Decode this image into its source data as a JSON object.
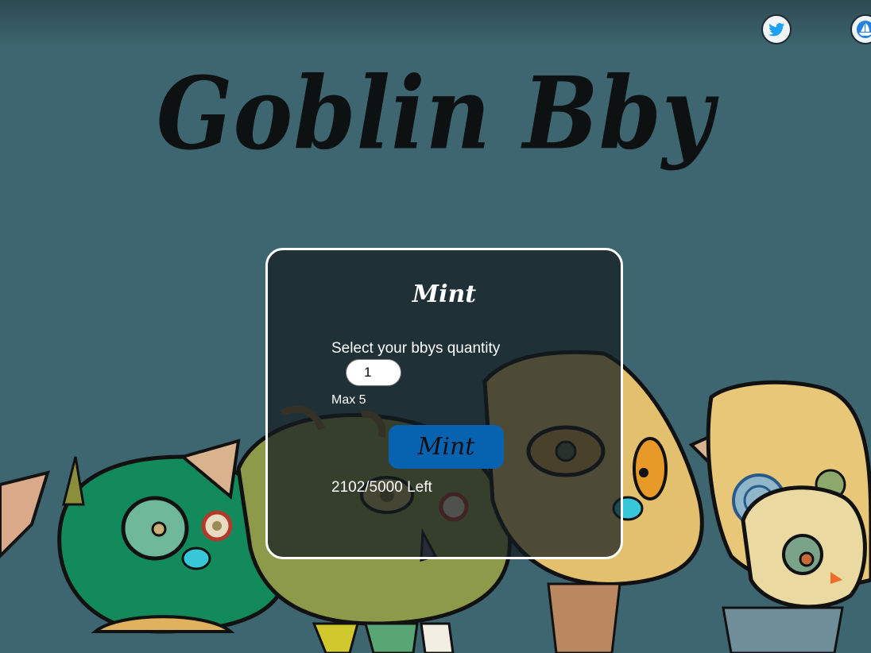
{
  "header": {
    "title": "Goblin Bby",
    "social": [
      {
        "name": "twitter",
        "icon": "twitter-bird-icon",
        "color": "#1da1f2"
      },
      {
        "name": "opensea",
        "icon": "opensea-boat-icon",
        "color": "#2081e2"
      }
    ]
  },
  "mint_panel": {
    "title": "Mint",
    "select_label": "Select your bbys quantity",
    "quantity_value": "1",
    "max_label": "Max 5",
    "mint_button_label": "Mint",
    "remaining_label": "2102/5000 Left"
  },
  "colors": {
    "background": "#3e6670",
    "mint_button": "#0762b0",
    "panel_border": "#ffffff"
  }
}
